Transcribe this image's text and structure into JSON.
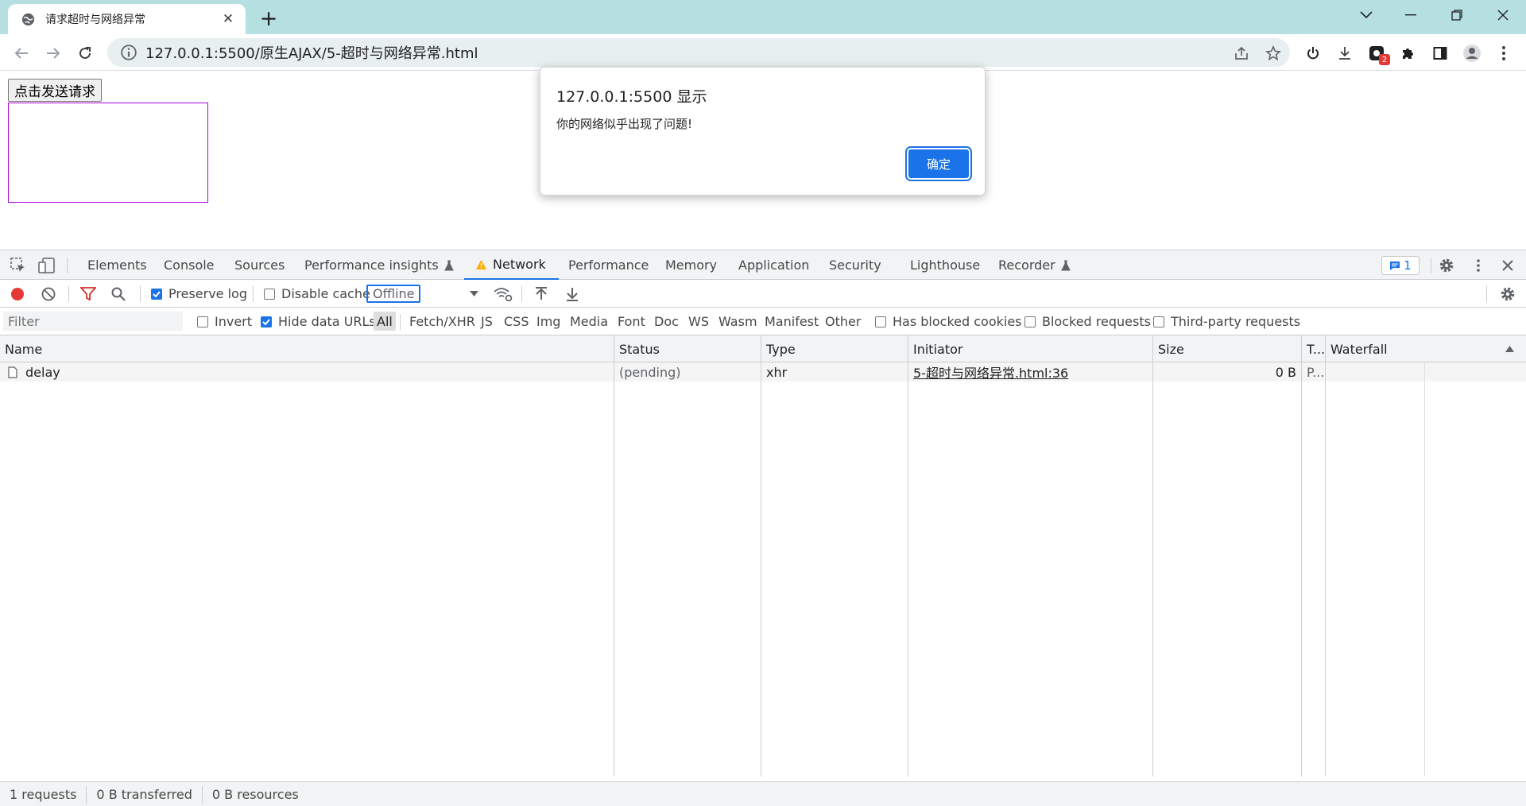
{
  "browser": {
    "tab_title": "请求超时与网络异常",
    "url": "127.0.0.1:5500/原生AJAX/5-超时与网络异常.html",
    "extension_badge": "2"
  },
  "page": {
    "send_button": "点击发送请求"
  },
  "dialog": {
    "title": "127.0.0.1:5500 显示",
    "message": "你的网络似乎出现了问题!",
    "ok": "确定"
  },
  "devtools": {
    "tabs": [
      "Elements",
      "Console",
      "Sources",
      "Performance insights",
      "Network",
      "Performance",
      "Memory",
      "Application",
      "Security",
      "Lighthouse",
      "Recorder"
    ],
    "active_tab": "Network",
    "issues_count": "1",
    "toolbar": {
      "preserve_log": "Preserve log",
      "preserve_log_checked": true,
      "disable_cache": "Disable cache",
      "disable_cache_checked": false,
      "throttling": "Offline"
    },
    "filter": {
      "placeholder": "Filter",
      "invert": "Invert",
      "hide_data_urls": "Hide data URLs",
      "types": [
        "All",
        "Fetch/XHR",
        "JS",
        "CSS",
        "Img",
        "Media",
        "Font",
        "Doc",
        "WS",
        "Wasm",
        "Manifest",
        "Other"
      ],
      "active_type": "All",
      "has_blocked_cookies": "Has blocked cookies",
      "blocked_requests": "Blocked requests",
      "third_party": "Third-party requests"
    },
    "table": {
      "columns": [
        "Name",
        "Status",
        "Type",
        "Initiator",
        "Size",
        "T...",
        "Waterfall"
      ],
      "rows": [
        {
          "name": "delay",
          "status": "(pending)",
          "type": "xhr",
          "initiator": "5-超时与网络异常.html:36",
          "size": "0 B",
          "time": "P..."
        }
      ]
    },
    "status": {
      "requests": "1 requests",
      "transferred": "0 B transferred",
      "resources": "0 B resources"
    }
  },
  "colors": {
    "tabstrip": "#b6dfe1",
    "accent": "#1a73e8",
    "result_border": "#b000d6",
    "record": "#e53935"
  }
}
